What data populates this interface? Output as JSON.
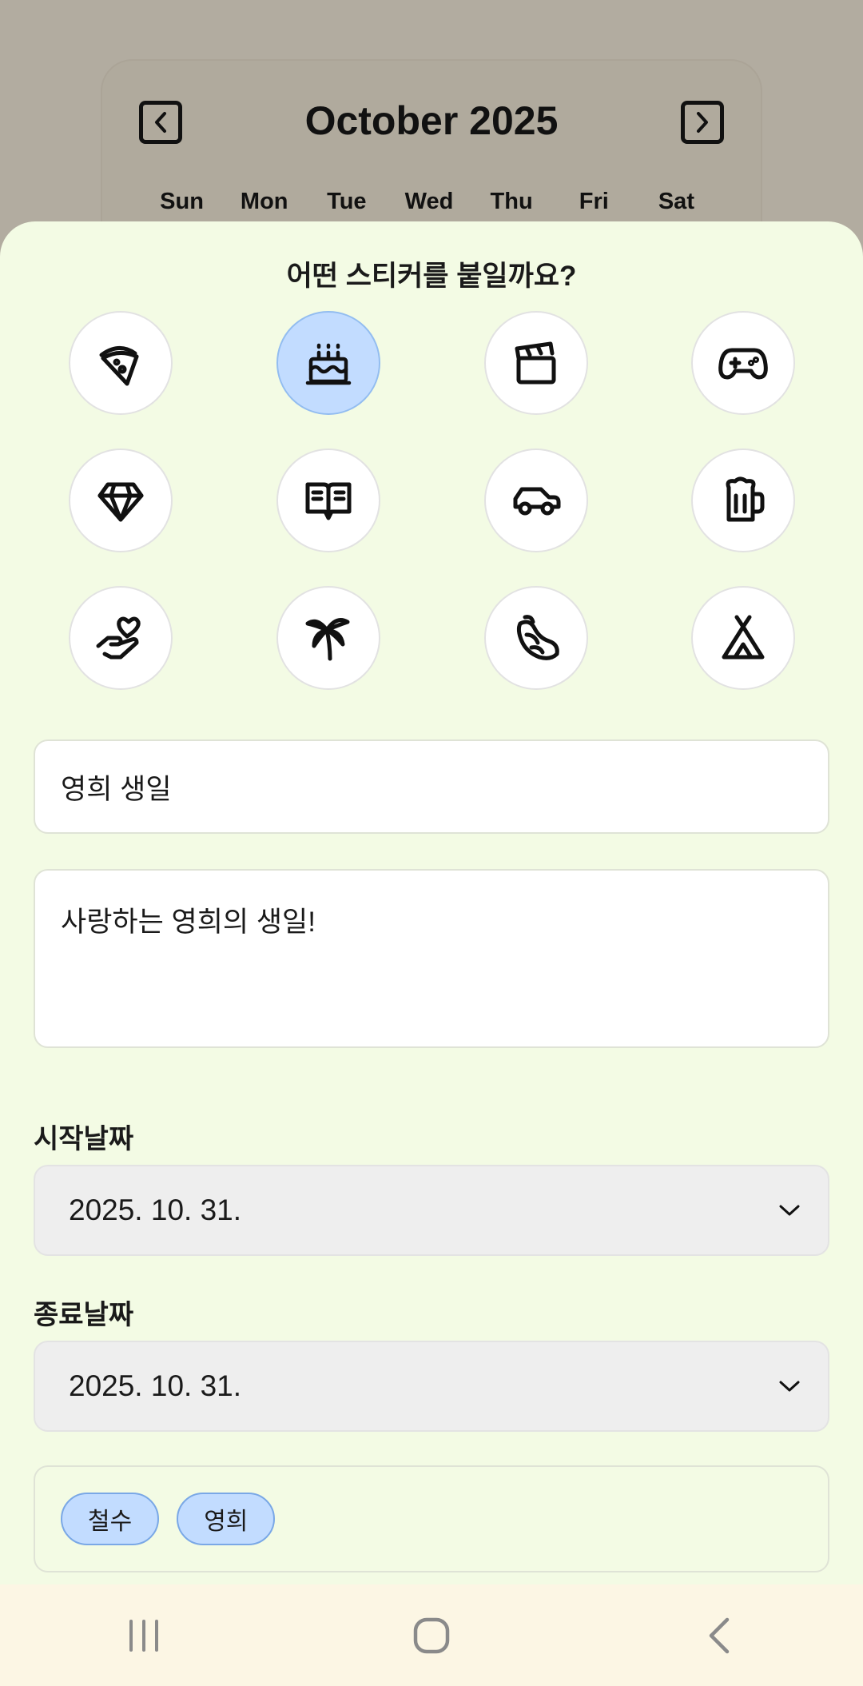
{
  "calendar": {
    "month_title": "October 2025",
    "weekdays": [
      "Sun",
      "Mon",
      "Tue",
      "Wed",
      "Thu",
      "Fri",
      "Sat"
    ]
  },
  "sheet": {
    "title": "어떤 스티커를 붙일까요?",
    "stickers": [
      {
        "icon": "pizza-icon",
        "selected": false
      },
      {
        "icon": "birthday-cake-icon",
        "selected": true
      },
      {
        "icon": "clapperboard-icon",
        "selected": false
      },
      {
        "icon": "gamepad-icon",
        "selected": false
      },
      {
        "icon": "diamond-icon",
        "selected": false
      },
      {
        "icon": "book-icon",
        "selected": false
      },
      {
        "icon": "car-icon",
        "selected": false
      },
      {
        "icon": "beer-mug-icon",
        "selected": false
      },
      {
        "icon": "hand-heart-icon",
        "selected": false
      },
      {
        "icon": "palm-tree-icon",
        "selected": false
      },
      {
        "icon": "croissant-icon",
        "selected": false
      },
      {
        "icon": "tent-icon",
        "selected": false
      }
    ],
    "event_title": "영희 생일",
    "memo": "사랑하는 영희의 생일!",
    "start_label": "시작날짜",
    "start_date": "2025. 10. 31.",
    "end_label": "종료날짜",
    "end_date": "2025. 10. 31.",
    "participants": [
      "철수",
      "영희"
    ]
  },
  "colors": {
    "sheet_bg": "#f3fbe4",
    "selected_sticker": "#c2dcff",
    "chip_bg": "#c2dcff",
    "select_bg": "#eeeeee",
    "navbar_bg": "#fcf6e4",
    "scrim": "#b2aca0"
  }
}
